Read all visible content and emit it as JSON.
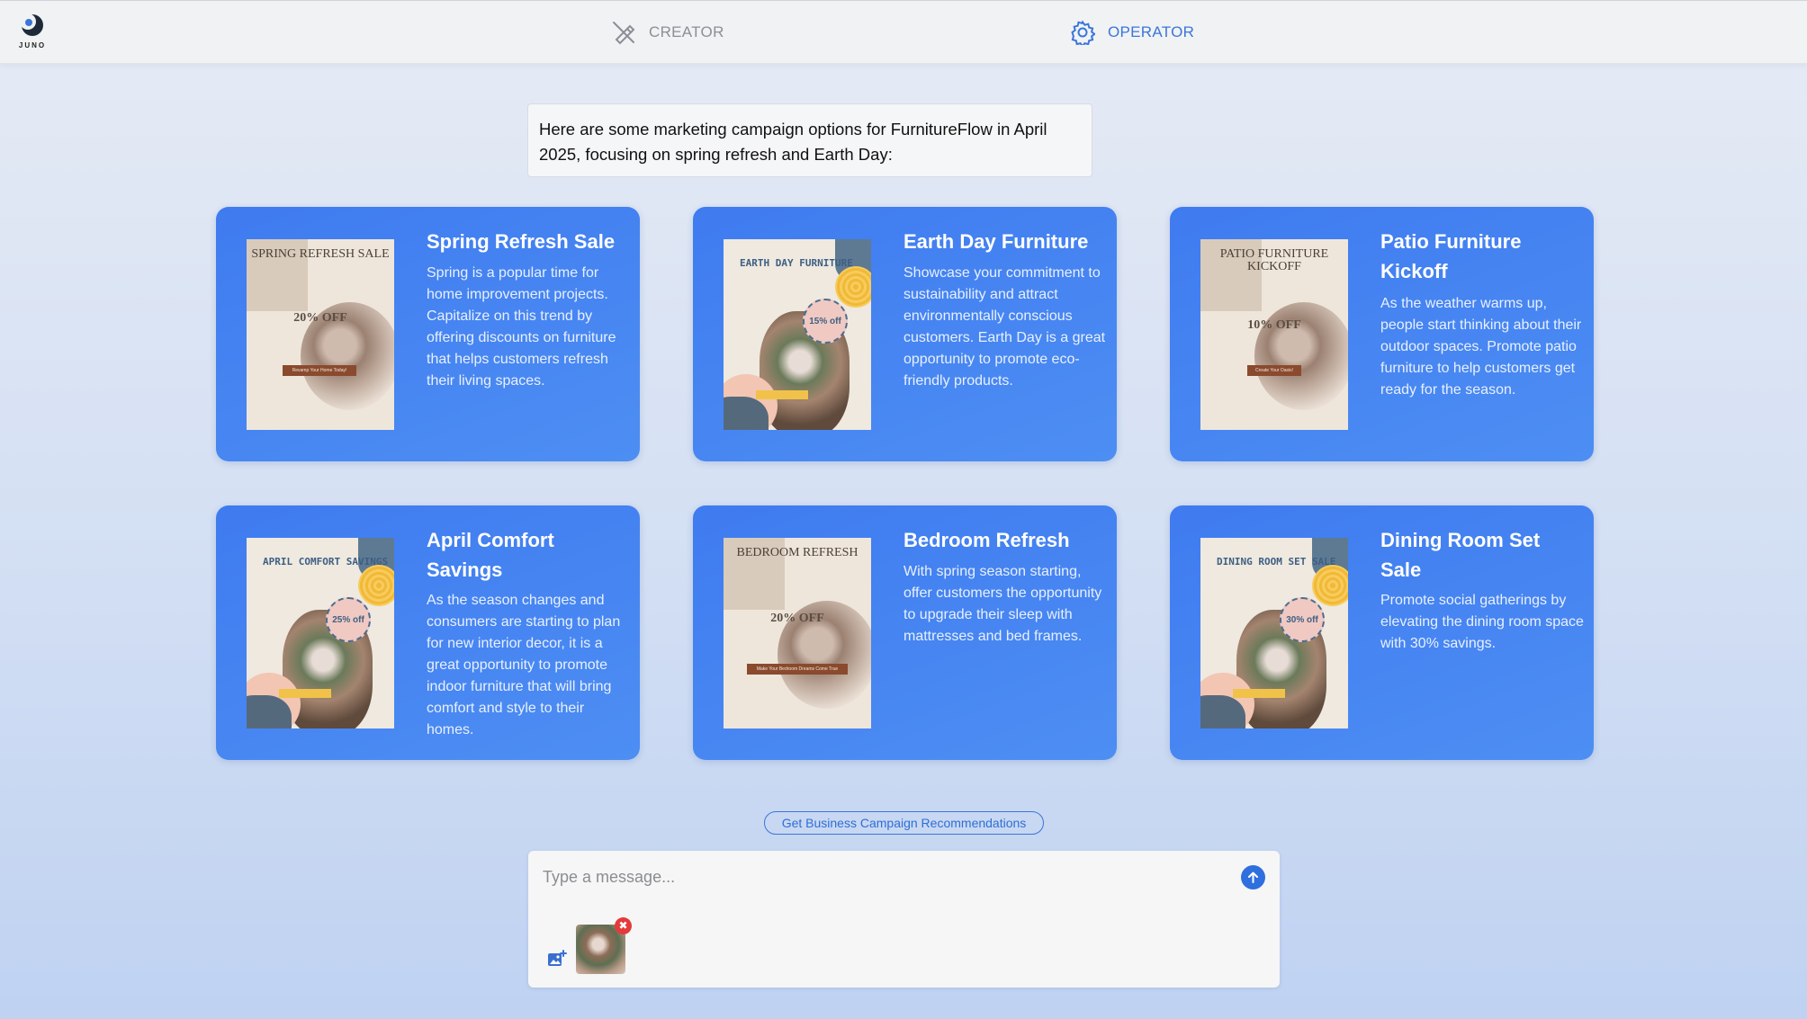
{
  "header": {
    "logo_text": "JUNO",
    "tabs": [
      {
        "label": "CREATOR",
        "icon": "pen-off-icon",
        "active": false
      },
      {
        "label": "OPERATOR",
        "icon": "gear-icon",
        "active": true
      }
    ]
  },
  "intro_message": "Here are some marketing campaign options for FurnitureFlow in April 2025, focusing on spring refresh and Earth Day:",
  "colors": {
    "accent": "#3a76d9",
    "card": "#4384f1",
    "remove": "#e43a3a"
  },
  "cards": [
    {
      "title": "Spring Refresh Sale",
      "description": "Spring is a popular time for home improvement projects. Capitalize on this trend by offering discounts on furniture that helps customers refresh their living spaces.",
      "poster": {
        "style": "serif",
        "heading": "SPRING REFRESH SALE",
        "offer": "20% OFF",
        "button": "Revamp Your Home Today!"
      }
    },
    {
      "title": "Earth Day Furniture",
      "description": "Showcase your commitment to sustainability and attract environmentally conscious customers. Earth Day is a great opportunity to promote eco-friendly products.",
      "poster": {
        "style": "bold",
        "heading": "EARTH DAY FURNITURE",
        "offer": "15% off"
      }
    },
    {
      "title": "Patio Furniture Kickoff",
      "description": "As the weather warms up, people start thinking about their outdoor spaces. Promote patio furniture to help customers get ready for the season.",
      "poster": {
        "style": "serif",
        "heading": "PATIO FURNITURE KICKOFF",
        "offer": "10% OFF",
        "button": "Create Your Oasis!"
      }
    },
    {
      "title": "April Comfort Savings",
      "description": "As the season changes and consumers are starting to plan for new interior decor, it is a great opportunity to promote indoor furniture that will bring comfort and style to their homes.",
      "poster": {
        "style": "bold",
        "heading": "APRIL COMFORT SAVINGS",
        "offer": "25% off"
      }
    },
    {
      "title": "Bedroom Refresh",
      "description": "With spring season starting, offer customers the opportunity to upgrade their sleep with mattresses and bed frames.",
      "poster": {
        "style": "serif",
        "heading": "BEDROOM REFRESH",
        "offer": "20% OFF",
        "button": "Make Your Bedroom Dreams Come True"
      }
    },
    {
      "title": "Dining Room Set Sale",
      "description": "Promote social gatherings by elevating the dining room space with 30% savings.",
      "poster": {
        "style": "bold",
        "heading": "DINING ROOM SET SALE",
        "offer": "30% off"
      }
    }
  ],
  "recommend_button": "Get Business Campaign Recommendations",
  "composer": {
    "placeholder": "Type a message...",
    "send_icon": "arrow-up-icon",
    "attach_icon": "add-image-icon",
    "remove_symbol": "✖"
  }
}
